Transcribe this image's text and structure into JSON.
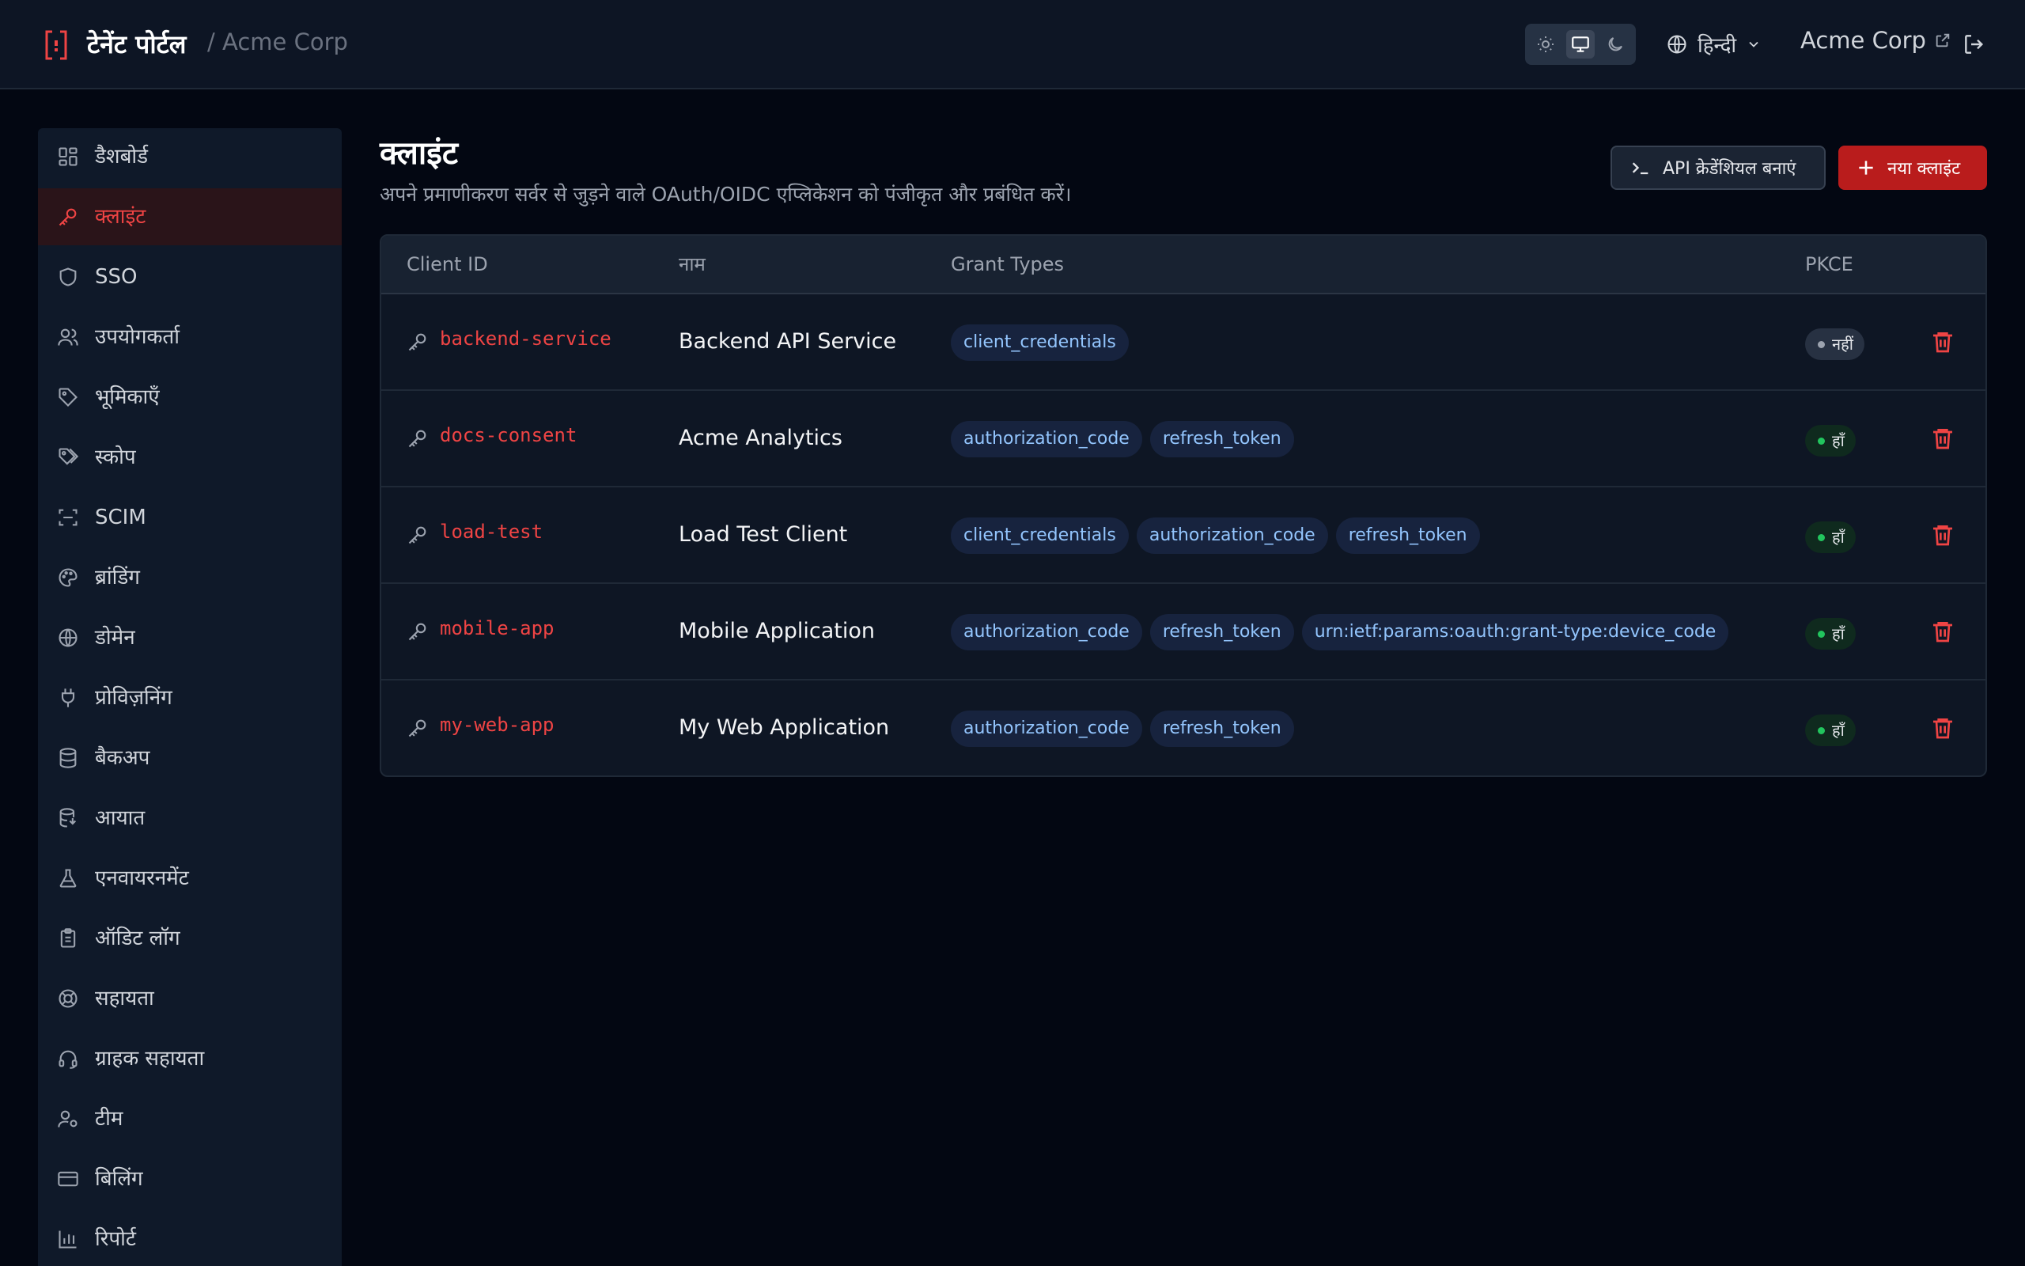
{
  "header": {
    "app_title": "टेनेंट पोर्टल",
    "tenant_crumb": "/ Acme Corp",
    "language": "हिन्दी",
    "org_name": "Acme Corp"
  },
  "sidebar": {
    "items": [
      {
        "label": "डैशबोर्ड",
        "icon": "dashboard-icon"
      },
      {
        "label": "क्लाइंट",
        "icon": "key-icon",
        "active": true
      },
      {
        "label": "SSO",
        "icon": "shield-icon"
      },
      {
        "label": "उपयोगकर्ता",
        "icon": "users-icon"
      },
      {
        "label": "भूमिकाएँ",
        "icon": "tag-icon"
      },
      {
        "label": "स्कोप",
        "icon": "tags-icon"
      },
      {
        "label": "SCIM",
        "icon": "scan-icon"
      },
      {
        "label": "ब्रांडिंग",
        "icon": "palette-icon"
      },
      {
        "label": "डोमेन",
        "icon": "globe-icon"
      },
      {
        "label": "प्रोविज़निंग",
        "icon": "plug-icon"
      },
      {
        "label": "बैकअप",
        "icon": "database-icon"
      },
      {
        "label": "आयात",
        "icon": "database-import-icon"
      },
      {
        "label": "एनवायरनमेंट",
        "icon": "flask-icon"
      },
      {
        "label": "ऑडिट लॉग",
        "icon": "clipboard-icon"
      },
      {
        "label": "सहायता",
        "icon": "lifebuoy-icon"
      },
      {
        "label": "ग्राहक सहायता",
        "icon": "headset-icon"
      },
      {
        "label": "टीम",
        "icon": "user-gear-icon"
      },
      {
        "label": "बिलिंग",
        "icon": "credit-card-icon"
      },
      {
        "label": "रिपोर्ट",
        "icon": "bar-chart-icon"
      }
    ]
  },
  "page": {
    "title": "क्लाइंट",
    "subtitle": "अपने प्रमाणीकरण सर्वर से जुड़ने वाले OAuth/OIDC एप्लिकेशन को पंजीकृत और प्रबंधित करें।",
    "api_button": "API क्रेडेंशियल बनाएं",
    "new_button": "नया क्लाइंट"
  },
  "table": {
    "headers": {
      "client_id": "Client ID",
      "name": "नाम",
      "grant_types": "Grant Types",
      "pkce": "PKCE"
    },
    "rows": [
      {
        "client_id": "backend-service",
        "name": "Backend API Service",
        "grants": [
          "client_credentials"
        ],
        "pkce": "नहीं",
        "pkce_on": false
      },
      {
        "client_id": "docs-consent",
        "name": "Acme Analytics",
        "grants": [
          "authorization_code",
          "refresh_token"
        ],
        "pkce": "हाँ",
        "pkce_on": true
      },
      {
        "client_id": "load-test",
        "name": "Load Test Client",
        "grants": [
          "client_credentials",
          "authorization_code",
          "refresh_token"
        ],
        "pkce": "हाँ",
        "pkce_on": true
      },
      {
        "client_id": "mobile-app",
        "name": "Mobile Application",
        "grants": [
          "authorization_code",
          "refresh_token",
          "urn:ietf:params:oauth:grant-type:device_code"
        ],
        "pkce": "हाँ",
        "pkce_on": true
      },
      {
        "client_id": "my-web-app",
        "name": "My Web Application",
        "grants": [
          "authorization_code",
          "refresh_token"
        ],
        "pkce": "हाँ",
        "pkce_on": true
      }
    ]
  },
  "colors": {
    "accent": "#ef4444",
    "pill_text": "#93c5fd",
    "pkce_yes": "#22c55e"
  }
}
